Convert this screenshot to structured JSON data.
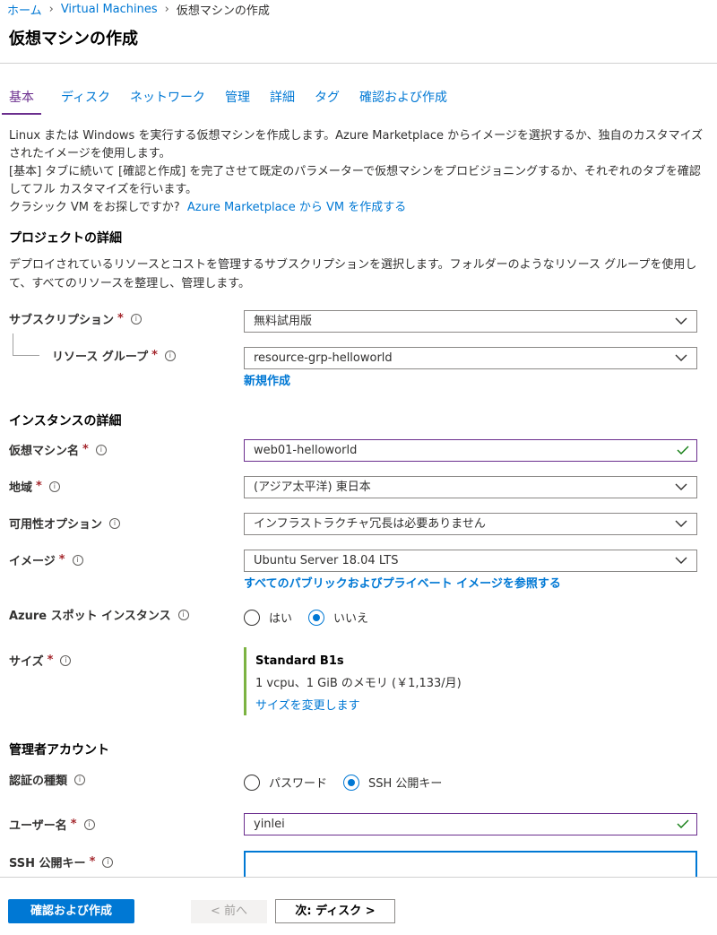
{
  "breadcrumb": {
    "home": "ホーム",
    "vms": "Virtual Machines",
    "current": "仮想マシンの作成"
  },
  "page": {
    "title": "仮想マシンの作成"
  },
  "tabs": [
    {
      "label": "基本",
      "active": true
    },
    {
      "label": "ディスク"
    },
    {
      "label": "ネットワーク"
    },
    {
      "label": "管理"
    },
    {
      "label": "詳細"
    },
    {
      "label": "タグ"
    },
    {
      "label": "確認および作成"
    }
  ],
  "intro": {
    "line1": "Linux または Windows を実行する仮想マシンを作成します。Azure Marketplace からイメージを選択するか、独自のカスタマイズされたイメージを使用します。",
    "line2": "[基本] タブに続いて [確認と作成] を完了させて既定のパラメーターで仮想マシンをプロビジョニングするか、それぞれのタブを確認してフル カスタマイズを行います。",
    "classic_q": "クラシック VM をお探しですか?",
    "classic_link": "Azure Marketplace から VM を作成する"
  },
  "project": {
    "heading": "プロジェクトの詳細",
    "desc": "デプロイされているリソースとコストを管理するサブスクリプションを選択します。フォルダーのようなリソース グループを使用して、すべてのリソースを整理し、管理します。",
    "subscription_label": "サブスクリプション",
    "subscription_value": "無料試用版",
    "rg_label": "リソース グループ",
    "rg_value": "resource-grp-helloworld",
    "rg_new": "新規作成"
  },
  "instance": {
    "heading": "インスタンスの詳細",
    "vmname_label": "仮想マシン名",
    "vmname_value": "web01-helloworld",
    "region_label": "地域",
    "region_value": "(アジア太平洋) 東日本",
    "avail_label": "可用性オプション",
    "avail_value": "インフラストラクチャ冗長は必要ありません",
    "image_label": "イメージ",
    "image_value": "Ubuntu Server 18.04 LTS",
    "image_link": "すべてのパブリックおよびプライベート イメージを参照する",
    "spot_label": "Azure スポット インスタンス",
    "spot_yes": "はい",
    "spot_no": "いいえ",
    "size_label": "サイズ",
    "size_name": "Standard B1s",
    "size_spec": "1 vcpu、1 GiB のメモリ (￥1,133/月)",
    "size_change": "サイズを変更します"
  },
  "admin": {
    "heading": "管理者アカウント",
    "auth_label": "認証の種類",
    "auth_password": "パスワード",
    "auth_ssh": "SSH 公開キー",
    "user_label": "ユーザー名",
    "user_value": "yinlei",
    "ssh_label": "SSH 公開キー"
  },
  "footer": {
    "review_create": "確認および作成",
    "prev": "< 前へ",
    "next": "次: ディスク >"
  },
  "colors": {
    "accent": "#0078d4",
    "active_tab": "#6b2e8e",
    "required": "#a4262c",
    "valid": "#107c10"
  },
  "icons": [
    "chevron-down-icon",
    "info-icon",
    "check-icon"
  ]
}
